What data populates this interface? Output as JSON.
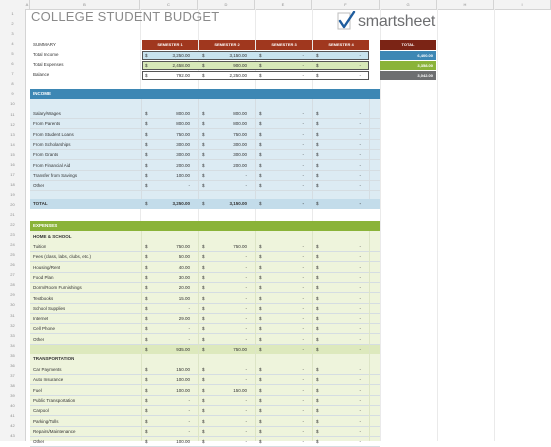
{
  "columns": [
    "A",
    "B",
    "C",
    "D",
    "E",
    "F",
    "G",
    "H",
    "I",
    "J"
  ],
  "rows": [
    "1",
    "2",
    "3",
    "4",
    "5",
    "6",
    "7",
    "8",
    "9",
    "10",
    "11",
    "12",
    "13",
    "14",
    "15",
    "16",
    "17",
    "18",
    "19",
    "20",
    "21",
    "22",
    "23",
    "24",
    "25",
    "26",
    "27",
    "28",
    "29",
    "30",
    "31",
    "32",
    "33",
    "34",
    "35",
    "36",
    "37",
    "38",
    "39",
    "40",
    "41",
    "42",
    "43"
  ],
  "title": "COLLEGE STUDENT BUDGET",
  "logo_word": "smartsheet",
  "summary": {
    "label": "SUMMARY",
    "semesters": [
      "SEMESTER 1",
      "SEMESTER 2",
      "SEMESTER 3",
      "SEMESTER 4"
    ],
    "total_label": "TOTAL",
    "rows": [
      {
        "label": "Total Income",
        "vals": [
          "3,250.00",
          "3,150.00",
          "-",
          "-"
        ],
        "total": "6,400.00"
      },
      {
        "label": "Total Expenses",
        "vals": [
          "2,458.00",
          "900.00",
          "-",
          "-"
        ],
        "total": "3,358.00"
      },
      {
        "label": "Balance",
        "vals": [
          "792.00",
          "2,250.00",
          "-",
          "-"
        ],
        "total": "3,042.00"
      }
    ]
  },
  "income": {
    "header": "INCOME",
    "rows": [
      {
        "label": "Salary/Wages",
        "vals": [
          "800.00",
          "800.00",
          "-",
          "-"
        ]
      },
      {
        "label": "From Parents",
        "vals": [
          "800.00",
          "800.00",
          "-",
          "-"
        ]
      },
      {
        "label": "From Student Loans",
        "vals": [
          "750.00",
          "750.00",
          "-",
          "-"
        ]
      },
      {
        "label": "From Scholarships",
        "vals": [
          "300.00",
          "300.00",
          "-",
          "-"
        ]
      },
      {
        "label": "From Grants",
        "vals": [
          "300.00",
          "300.00",
          "-",
          "-"
        ]
      },
      {
        "label": "From Financial Aid",
        "vals": [
          "200.00",
          "200.00",
          "-",
          "-"
        ]
      },
      {
        "label": "Transfer from Savings",
        "vals": [
          "100.00",
          "-",
          "-",
          "-"
        ]
      },
      {
        "label": "Other",
        "vals": [
          "-",
          "-",
          "-",
          "-"
        ]
      }
    ],
    "total_label": "TOTAL",
    "total": [
      "3,250.00",
      "3,150.00",
      "-",
      "-"
    ]
  },
  "expenses": {
    "header": "EXPENSES",
    "home_label": "HOME & SCHOOL",
    "home_rows": [
      {
        "label": "Tuition",
        "vals": [
          "750.00",
          "750.00",
          "-",
          "-"
        ]
      },
      {
        "label": "Fees (class, labs, clubs, etc.)",
        "vals": [
          "50.00",
          "-",
          "-",
          "-"
        ]
      },
      {
        "label": "Housing/Rent",
        "vals": [
          "40.00",
          "-",
          "-",
          "-"
        ]
      },
      {
        "label": "Food Plan",
        "vals": [
          "30.00",
          "-",
          "-",
          "-"
        ]
      },
      {
        "label": "Dorm/Room Furnishings",
        "vals": [
          "20.00",
          "-",
          "-",
          "-"
        ]
      },
      {
        "label": "Textbooks",
        "vals": [
          "15.00",
          "-",
          "-",
          "-"
        ]
      },
      {
        "label": "School Supplies",
        "vals": [
          "-",
          "-",
          "-",
          "-"
        ]
      },
      {
        "label": "Internet",
        "vals": [
          "29.00",
          "-",
          "-",
          "-"
        ]
      },
      {
        "label": "Cell Phone",
        "vals": [
          "-",
          "-",
          "-",
          "-"
        ]
      },
      {
        "label": "Other",
        "vals": [
          "-",
          "-",
          "-",
          "-"
        ]
      }
    ],
    "home_total": [
      "935.00",
      "750.00",
      "-",
      "-"
    ],
    "transport_label": "TRANSPORTATION",
    "transport_rows": [
      {
        "label": "Car Payments",
        "vals": [
          "150.00",
          "-",
          "-",
          "-"
        ]
      },
      {
        "label": "Auto Insurance",
        "vals": [
          "100.00",
          "-",
          "-",
          "-"
        ]
      },
      {
        "label": "Fuel",
        "vals": [
          "100.00",
          "150.00",
          "-",
          "-"
        ]
      },
      {
        "label": "Public Transportation",
        "vals": [
          "-",
          "-",
          "-",
          "-"
        ]
      },
      {
        "label": "Carpool",
        "vals": [
          "-",
          "-",
          "-",
          "-"
        ]
      },
      {
        "label": "Parking/Tolls",
        "vals": [
          "-",
          "-",
          "-",
          "-"
        ]
      },
      {
        "label": "Repairs/Maintenance",
        "vals": [
          "-",
          "-",
          "-",
          "-"
        ]
      },
      {
        "label": "Other",
        "vals": [
          "100.00",
          "-",
          "-",
          "-"
        ]
      }
    ]
  },
  "dollar": "$",
  "colors": {
    "semester_header": "#a0371e",
    "total_header": "#7b2415",
    "income_band": "#3d87b4",
    "income_shade": "#dcebf3",
    "expense_band": "#8ab339",
    "expense_shade": "#eef4dc",
    "summary_income": "#c8e3ee",
    "summary_expense": "#d7e8b8",
    "total_income": "#3d87b4",
    "total_expense": "#8ab339",
    "total_balance": "#6d6e70"
  }
}
